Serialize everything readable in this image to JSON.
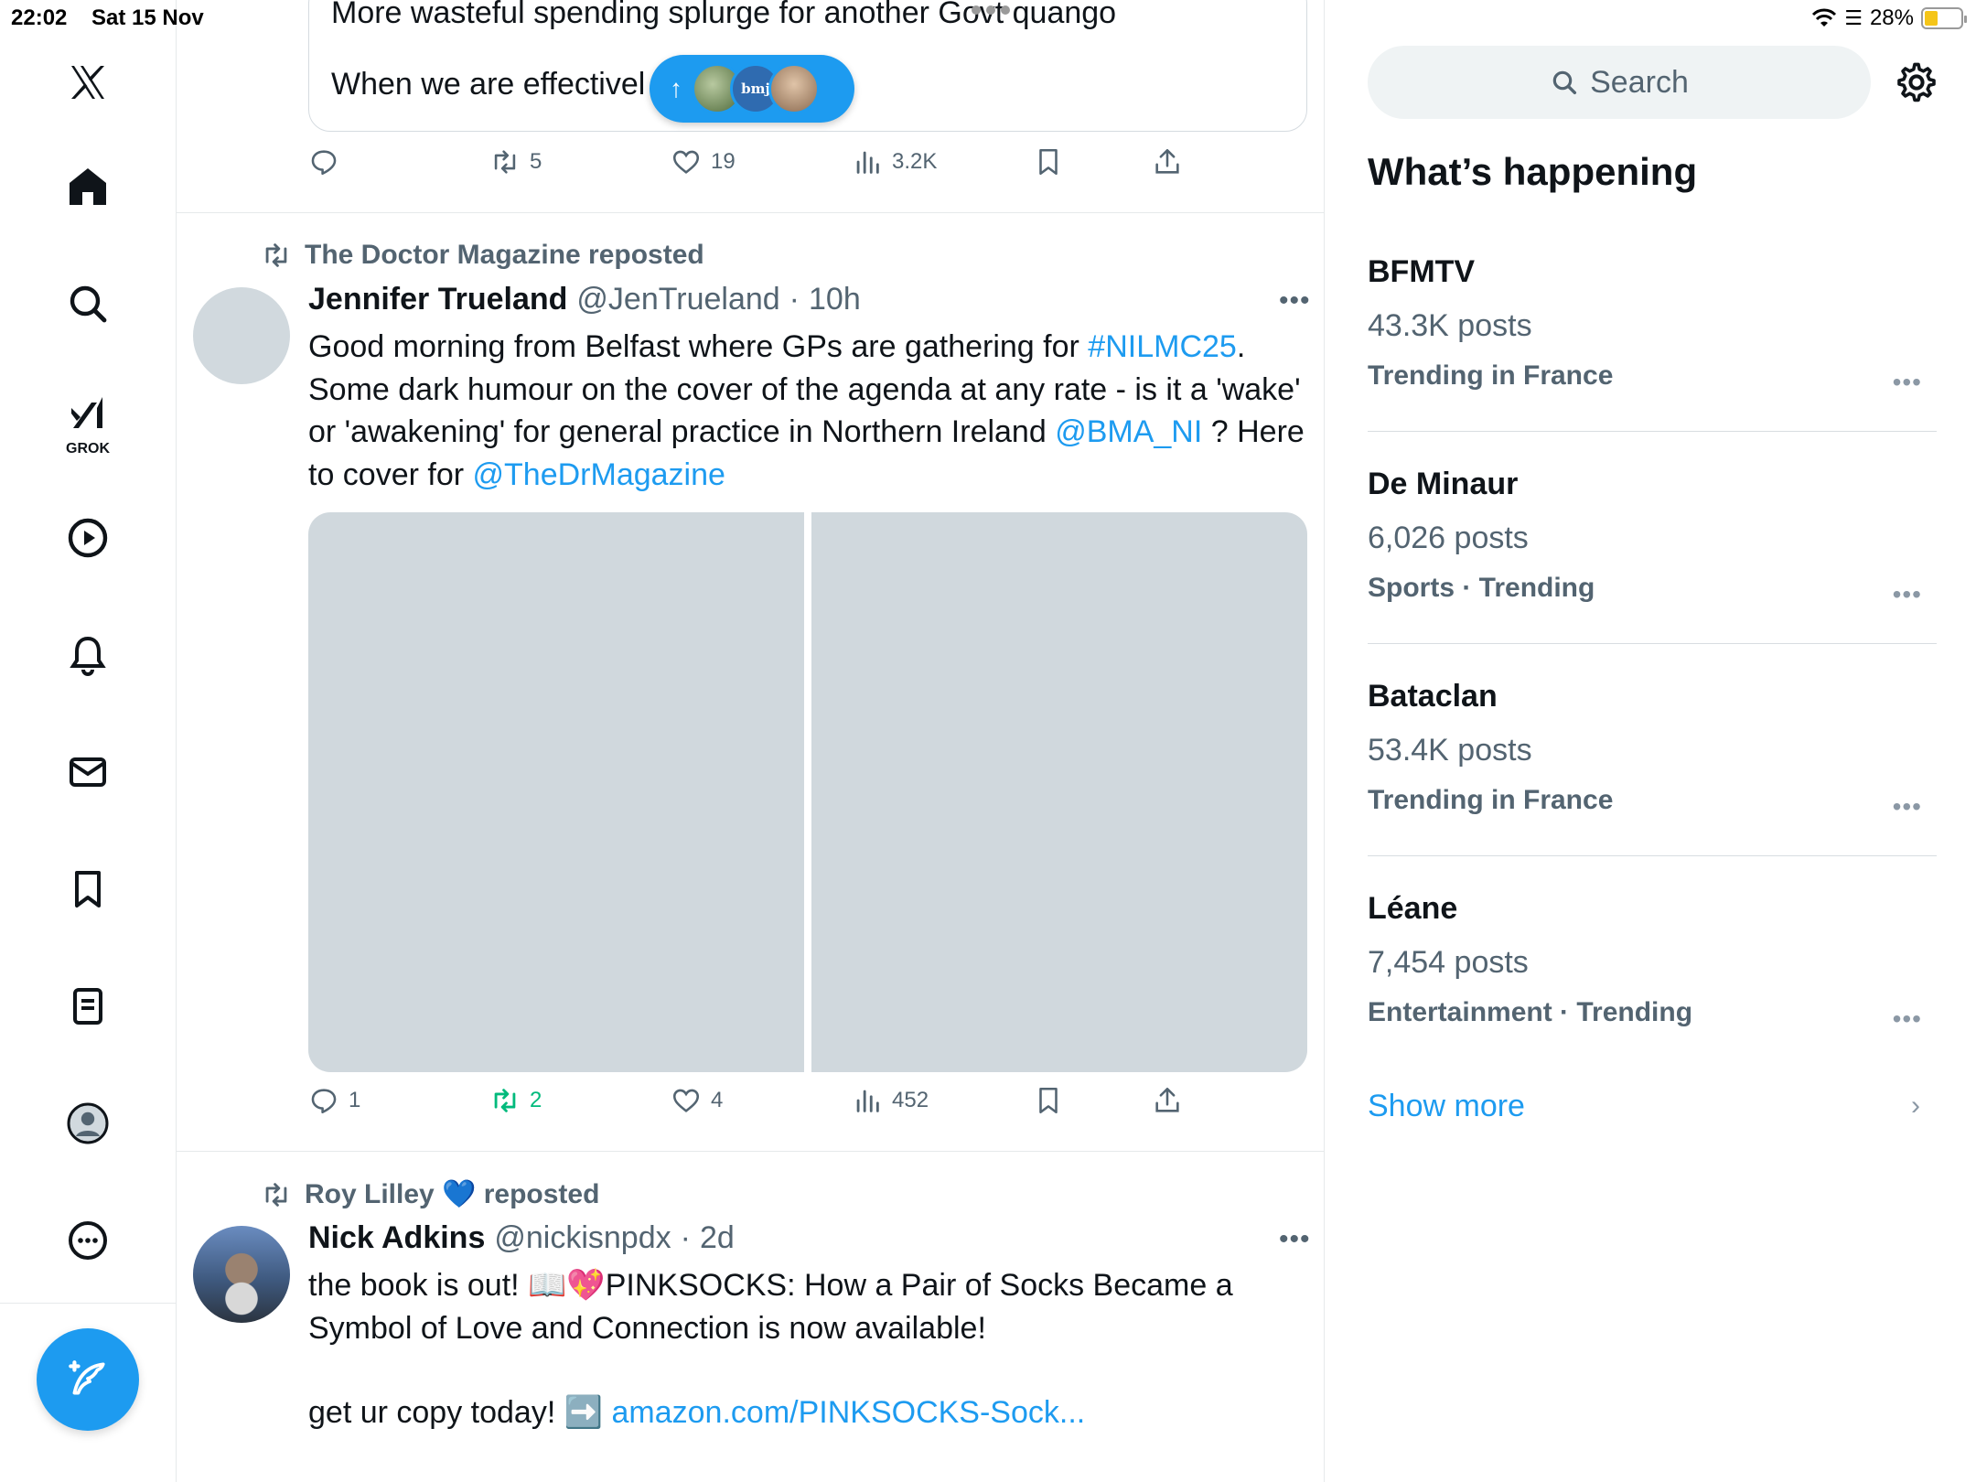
{
  "status_bar": {
    "time": "22:02",
    "date": "Sat 15 Nov",
    "battery": "28%"
  },
  "nav": {
    "items": [
      "x-logo",
      "home",
      "explore",
      "grok",
      "videos",
      "notifications",
      "messages",
      "bookmarks",
      "lists",
      "profile",
      "more"
    ],
    "grok_label": "GROK",
    "compose_icon": "compose-icon"
  },
  "feed": {
    "quote": {
      "line1": "More wasteful spending splurge for another Govt quango",
      "line2": "When we are effectivel",
      "pill_badge": "bmj"
    },
    "top_actions": {
      "replies": "",
      "reposts": "5",
      "likes": "19",
      "views": "3.2K"
    },
    "tweets": [
      {
        "repost_label": "The Doctor Magazine reposted",
        "name": "Jennifer Trueland",
        "handle": "@JenTrueland",
        "sep": "·",
        "time": "10h",
        "text_1": "Good morning from Belfast where GPs are gathering for ",
        "hashtag": "#NILMC25",
        "text_2": ". Some dark humour on the cover of the agenda at any rate - is it a 'wake' or 'awakening' for general practice in Northern Ireland ",
        "mention_1": "@BMA_NI",
        "text_3": " ? Here to cover for ",
        "mention_2": "@TheDrMagazine",
        "actions": {
          "replies": "1",
          "reposts": "2",
          "likes": "4",
          "views": "452"
        }
      },
      {
        "repost_label": "Roy Lilley 💙 reposted",
        "name": "Nick Adkins",
        "handle": "@nickisnpdx",
        "sep": "·",
        "time": "2d",
        "text_1": "the book is out! 📖💖PINKSOCKS: How a Pair of Socks Became a Symbol of Love and Connection is now available!",
        "text_2": "get ur copy today! ➡️ ",
        "link": "amazon.com/PINKSOCKS-Sock..."
      }
    ]
  },
  "sidebar": {
    "search_placeholder": "Search",
    "title": "What’s happening",
    "trends": [
      {
        "name": "BFMTV",
        "count": "43.3K posts",
        "meta": "Trending in France"
      },
      {
        "name": "De Minaur",
        "count": "6,026 posts",
        "meta": "Sports · Trending"
      },
      {
        "name": "Bataclan",
        "count": "53.4K posts",
        "meta": "Trending in France"
      },
      {
        "name": "Léane",
        "count": "7,454 posts",
        "meta": "Entertainment · Trending"
      }
    ],
    "show_more": "Show more"
  },
  "colors": {
    "accent": "#1d9bf0",
    "secondary_text": "#536471",
    "repost_green": "#00ba7c"
  }
}
